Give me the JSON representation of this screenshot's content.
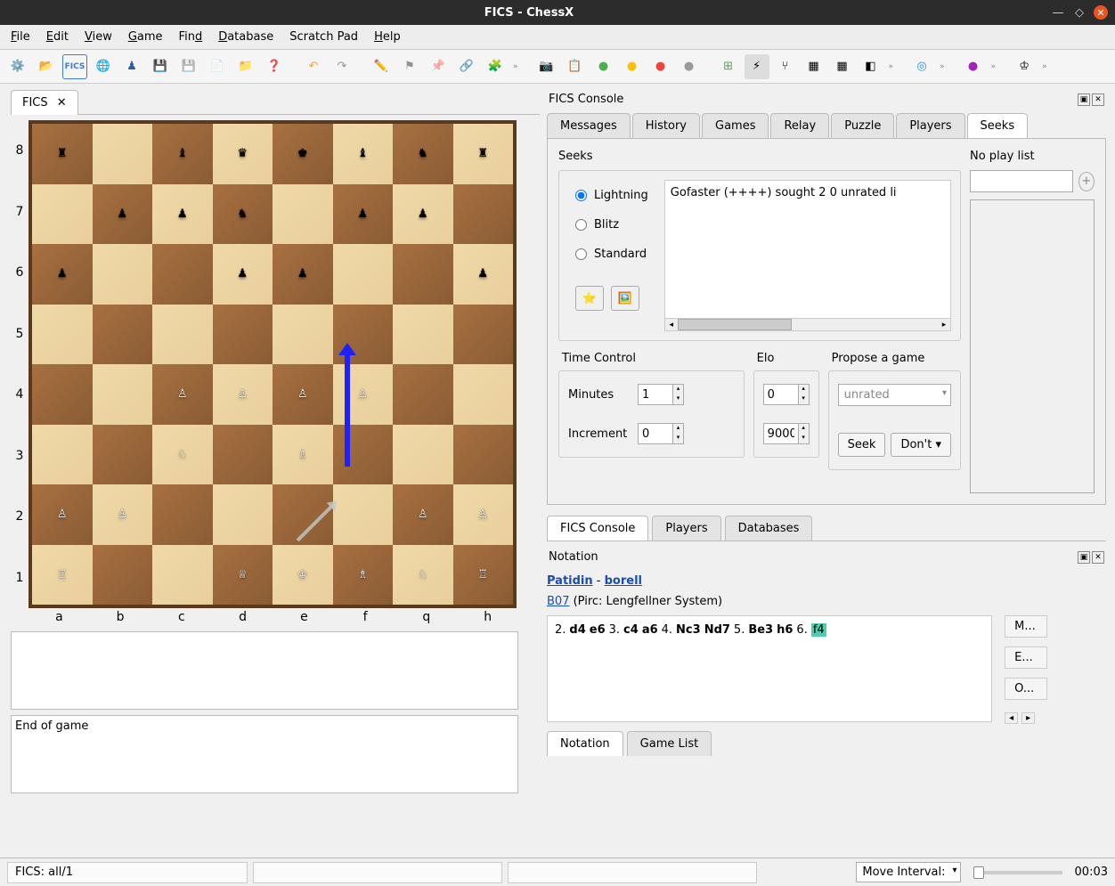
{
  "window": {
    "title": "FICS - ChessX"
  },
  "menubar": [
    "File",
    "Edit",
    "View",
    "Game",
    "Find",
    "Database",
    "Scratch Pad",
    "Help"
  ],
  "left_tab": "FICS",
  "board": {
    "ranks": [
      "8",
      "7",
      "6",
      "5",
      "4",
      "3",
      "2",
      "1"
    ],
    "files": [
      "a",
      "b",
      "c",
      "d",
      "e",
      "f",
      "q",
      "h"
    ],
    "pieces": {
      "a8": "♜",
      "c8": "♝",
      "d8": "♛",
      "e8": "♚",
      "f8": "♝",
      "g8": "♞",
      "h8": "♜",
      "b7": "♟",
      "c7": "♟",
      "d7": "♞",
      "f7": "♟",
      "g7": "♟",
      "a6": "♟",
      "d6": "♟",
      "e6": "♟",
      "h6": "♟",
      "c4": "♙",
      "d4": "♙",
      "e4": "♙",
      "f4": "♙",
      "c3": "♘",
      "e3": "♗",
      "a2": "♙",
      "b2": "♙",
      "g2": "♙",
      "h2": "♙",
      "a1": "♖",
      "d1": "♕",
      "e1": "♔",
      "f1": "♗",
      "g1": "♘",
      "h1": "♖"
    }
  },
  "end_of_game": "End of game",
  "console": {
    "title": "FICS Console",
    "tabs": [
      "Messages",
      "History",
      "Games",
      "Relay",
      "Puzzle",
      "Players",
      "Seeks"
    ],
    "active_tab": "Seeks",
    "seeks_label": "Seeks",
    "noplay_label": "No play list",
    "seek_text": "Gofaster (++++) sought 2 0 unrated li",
    "radios": [
      "Lightning",
      "Blitz",
      "Standard"
    ],
    "time_control_label": "Time Control",
    "minutes_label": "Minutes",
    "minutes_value": "1",
    "increment_label": "Increment",
    "increment_value": "0",
    "elo_label": "Elo",
    "elo_min": "0",
    "elo_max": "9000",
    "propose_label": "Propose a game",
    "propose_select": "unrated",
    "seek_btn": "Seek",
    "dont_btn": "Don't"
  },
  "mid_tabs": [
    "FICS Console",
    "Players",
    "Databases"
  ],
  "mid_active": "FICS Console",
  "notation": {
    "title": "Notation",
    "white": "Patidin",
    "black": "borell",
    "eco_code": "B07",
    "eco_name": " (Pirc: Lengfellner System)",
    "moves": [
      {
        "num": "2.",
        "w": "d4",
        "b": "e6"
      },
      {
        "num": "3.",
        "w": "c4",
        "b": "a6"
      },
      {
        "num": "4.",
        "w": "Nc3",
        "b": "Nd7"
      },
      {
        "num": "5.",
        "w": "Be3",
        "b": "h6"
      },
      {
        "num": "6.",
        "w_hl": "f4"
      }
    ],
    "side_btns": [
      "M...",
      "E...",
      "O..."
    ]
  },
  "bottom_tabs": [
    "Notation",
    "Game List"
  ],
  "bottom_active": "Notation",
  "status": {
    "fics": "FICS: all/1",
    "move_interval": "Move Interval:",
    "time": "00:03"
  }
}
